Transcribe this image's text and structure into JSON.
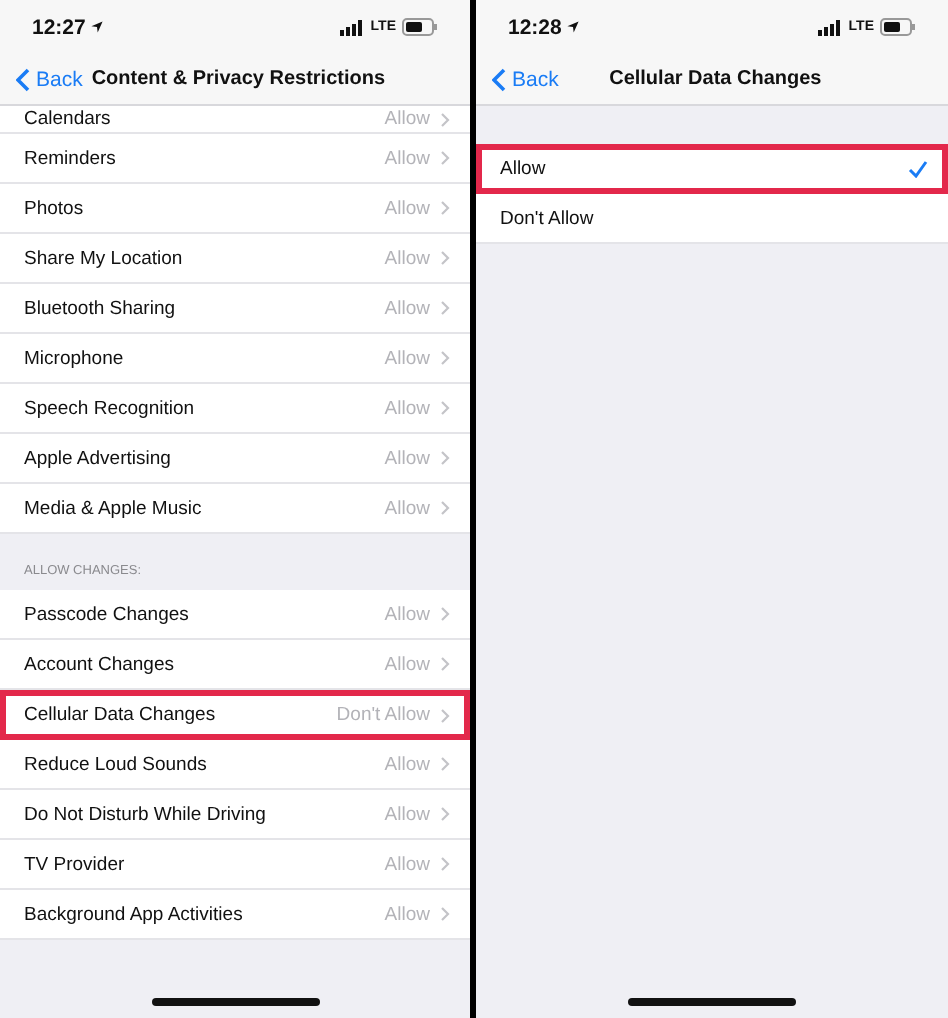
{
  "screens": [
    {
      "status_bar": {
        "time": "12:27",
        "network": "LTE"
      },
      "nav": {
        "back": "Back",
        "title": "Content & Privacy Restrictions"
      },
      "sections": [
        {
          "rows": [
            {
              "kind": "setting",
              "label": "Calendars",
              "value": "Allow",
              "highlighted": false
            },
            {
              "kind": "setting",
              "label": "Reminders",
              "value": "Allow",
              "highlighted": false
            },
            {
              "kind": "setting",
              "label": "Photos",
              "value": "Allow",
              "highlighted": false
            },
            {
              "kind": "setting",
              "label": "Share My Location",
              "value": "Allow",
              "highlighted": false
            },
            {
              "kind": "setting",
              "label": "Bluetooth Sharing",
              "value": "Allow",
              "highlighted": false
            },
            {
              "kind": "setting",
              "label": "Microphone",
              "value": "Allow",
              "highlighted": false
            },
            {
              "kind": "setting",
              "label": "Speech Recognition",
              "value": "Allow",
              "highlighted": false
            },
            {
              "kind": "setting",
              "label": "Apple Advertising",
              "value": "Allow",
              "highlighted": false
            },
            {
              "kind": "setting",
              "label": "Media & Apple Music",
              "value": "Allow",
              "highlighted": false
            }
          ]
        },
        {
          "header": "ALLOW CHANGES:",
          "rows": [
            {
              "kind": "setting",
              "label": "Passcode Changes",
              "value": "Allow",
              "highlighted": false
            },
            {
              "kind": "setting",
              "label": "Account Changes",
              "value": "Allow",
              "highlighted": false
            },
            {
              "kind": "setting",
              "label": "Cellular Data Changes",
              "value": "Don't Allow",
              "highlighted": true
            },
            {
              "kind": "setting",
              "label": "Reduce Loud Sounds",
              "value": "Allow",
              "highlighted": false
            },
            {
              "kind": "setting",
              "label": "Do Not Disturb While Driving",
              "value": "Allow",
              "highlighted": false
            },
            {
              "kind": "setting",
              "label": "TV Provider",
              "value": "Allow",
              "highlighted": false
            },
            {
              "kind": "setting",
              "label": "Background App Activities",
              "value": "Allow",
              "highlighted": false
            }
          ]
        }
      ]
    },
    {
      "status_bar": {
        "time": "12:28",
        "network": "LTE"
      },
      "nav": {
        "back": "Back",
        "title": "Cellular Data Changes"
      },
      "sections": [
        {
          "rows": [
            {
              "kind": "option",
              "label": "Allow",
              "selected": true,
              "highlighted": true
            },
            {
              "kind": "option",
              "label": "Don't Allow",
              "selected": false,
              "highlighted": false
            }
          ]
        }
      ]
    }
  ]
}
